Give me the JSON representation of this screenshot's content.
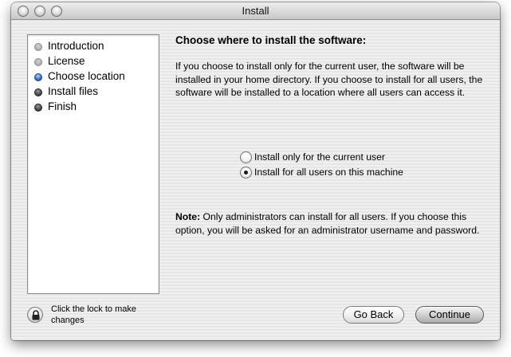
{
  "window": {
    "title": "Install"
  },
  "sidebar": {
    "steps": [
      {
        "label": "Introduction",
        "status": "done"
      },
      {
        "label": "License",
        "status": "done"
      },
      {
        "label": "Choose location",
        "status": "current"
      },
      {
        "label": "Install files",
        "status": "pending"
      },
      {
        "label": "Finish",
        "status": "pending"
      }
    ]
  },
  "main": {
    "heading": "Choose where to install the software:",
    "description": "If you choose to install only for the current user, the software will be installed in your home directory. If you choose to install for all users, the software will be installed to a location where all users can access it.",
    "options": [
      {
        "label": "Install only for the current user",
        "selected": false
      },
      {
        "label": "Install for all users on this machine",
        "selected": true
      }
    ],
    "note_prefix": "Note:",
    "note_text": " Only administrators can install for all users. If you choose this option, you will be asked for an administrator username and password."
  },
  "footer": {
    "lock_text": "Click the lock to make changes",
    "back_label": "Go Back",
    "continue_label": "Continue"
  }
}
